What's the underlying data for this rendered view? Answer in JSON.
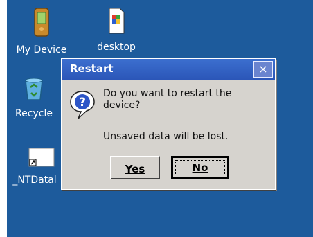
{
  "desktop": {
    "icons": [
      {
        "label": "My Device",
        "icon": "handheld-device-icon"
      },
      {
        "label": "desktop",
        "icon": "document-shortcut-icon"
      },
      {
        "label": "Recycle",
        "icon": "recycle-bin-icon"
      },
      {
        "label": "_NTDatal",
        "icon": "shortcut-file-icon"
      }
    ]
  },
  "dialog": {
    "title": "Restart",
    "close_label": "×",
    "message": "Do you want to restart the device?",
    "warning": "Unsaved data will be lost.",
    "yes_label": "Yes",
    "no_label": "No"
  },
  "colors": {
    "desktop_bg": "#1d5b9c",
    "titlebar": "#2b56b8",
    "dialog_bg": "#d6d3ce"
  }
}
